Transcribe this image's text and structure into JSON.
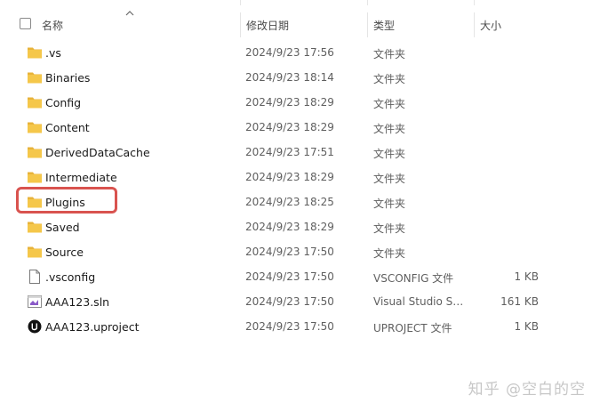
{
  "header": {
    "name_label": "名称",
    "date_label": "修改日期",
    "type_label": "类型",
    "size_label": "大小"
  },
  "files": [
    {
      "name": ".vs",
      "date": "2024/9/23 17:56",
      "type": "文件夹",
      "size": "",
      "icon": "folder-icon"
    },
    {
      "name": "Binaries",
      "date": "2024/9/23 18:14",
      "type": "文件夹",
      "size": "",
      "icon": "folder-icon"
    },
    {
      "name": "Config",
      "date": "2024/9/23 18:29",
      "type": "文件夹",
      "size": "",
      "icon": "folder-icon"
    },
    {
      "name": "Content",
      "date": "2024/9/23 18:29",
      "type": "文件夹",
      "size": "",
      "icon": "folder-icon"
    },
    {
      "name": "DerivedDataCache",
      "date": "2024/9/23 17:51",
      "type": "文件夹",
      "size": "",
      "icon": "folder-icon"
    },
    {
      "name": "Intermediate",
      "date": "2024/9/23 18:29",
      "type": "文件夹",
      "size": "",
      "icon": "folder-icon"
    },
    {
      "name": "Plugins",
      "date": "2024/9/23 18:25",
      "type": "文件夹",
      "size": "",
      "icon": "folder-icon"
    },
    {
      "name": "Saved",
      "date": "2024/9/23 18:29",
      "type": "文件夹",
      "size": "",
      "icon": "folder-icon"
    },
    {
      "name": "Source",
      "date": "2024/9/23 17:50",
      "type": "文件夹",
      "size": "",
      "icon": "folder-icon"
    },
    {
      "name": ".vsconfig",
      "date": "2024/9/23 17:50",
      "type": "VSCONFIG 文件",
      "size": "1 KB",
      "icon": "document-icon"
    },
    {
      "name": "AAA123.sln",
      "date": "2024/9/23 17:50",
      "type": "Visual Studio Sol...",
      "size": "161 KB",
      "icon": "visual-studio-solution-icon"
    },
    {
      "name": "AAA123.uproject",
      "date": "2024/9/23 17:50",
      "type": "UPROJECT 文件",
      "size": "1 KB",
      "icon": "unreal-engine-icon"
    }
  ],
  "highlighted_item": "Plugins",
  "colors": {
    "highlight": "#d9534f",
    "folder": "#f5c74a",
    "folder_tab": "#e8b33a"
  },
  "watermark": "知乎 @空白的空"
}
